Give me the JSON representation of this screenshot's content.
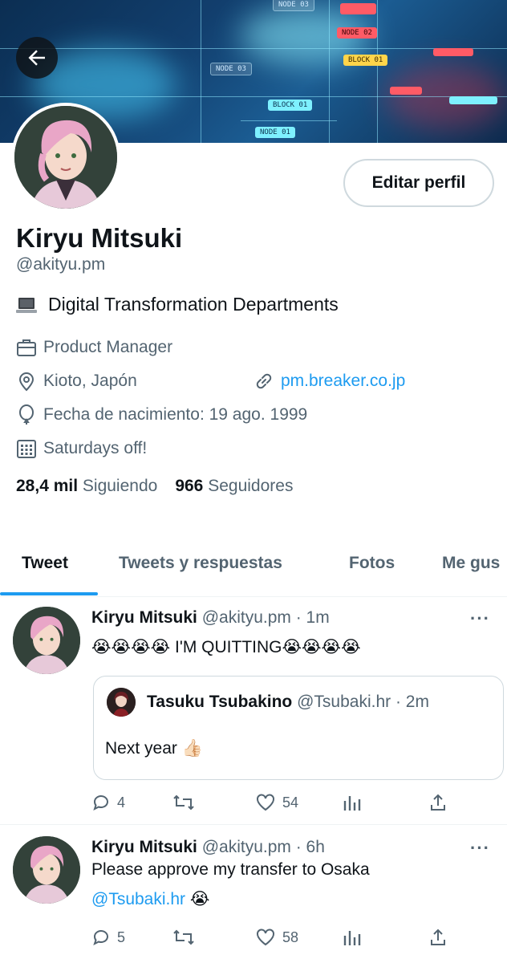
{
  "banner": {
    "nodes": [
      "NODE 03",
      "NODE 02",
      "NODE 03",
      "BLOCK 01",
      "BLOCK 01",
      "NODE 01"
    ]
  },
  "profile": {
    "name": "Kiryu Mitsuki",
    "handle": "@akityu.pm",
    "edit_label": "Editar perfil",
    "bio": "Digital Transformation Departments",
    "bio_icon": "laptop-emoji",
    "job": "Product Manager",
    "location": "Kioto, Japón",
    "website": "pm.breaker.co.jp",
    "birthday": "Fecha de nacimiento: 19 ago. 1999",
    "schedule": "Saturdays off!",
    "following_count": "28,4 mil",
    "following_label": "Siguiendo",
    "followers_count": "966",
    "followers_label": "Seguidores"
  },
  "tabs": [
    "Tweet",
    "Tweets y respuestas",
    "Fotos",
    "Me gus"
  ],
  "tweets": [
    {
      "name": "Kiryu Mitsuki",
      "meta": "@akityu.pm · 1m",
      "text": "😭😭😭😭 I'M QUITTING😭😭😭😭",
      "quote": {
        "name": "Tasuku Tsubakino",
        "meta": "@Tsubaki.hr · 2m",
        "text": "Next year 👍🏻"
      },
      "replies": "4",
      "retweets": "",
      "likes": "54"
    },
    {
      "name": "Kiryu Mitsuki",
      "meta": "@akityu.pm · 6h",
      "text": "Please approve my transfer to Osaka",
      "mention": "@Tsubaki.hr",
      "mention_suffix": " 😭",
      "replies": "5",
      "retweets": "",
      "likes": "58"
    }
  ],
  "colors": {
    "accent": "#1d9bf0",
    "secondary_text": "#536471",
    "primary_text": "#0f1419",
    "border": "#cfd9de"
  }
}
